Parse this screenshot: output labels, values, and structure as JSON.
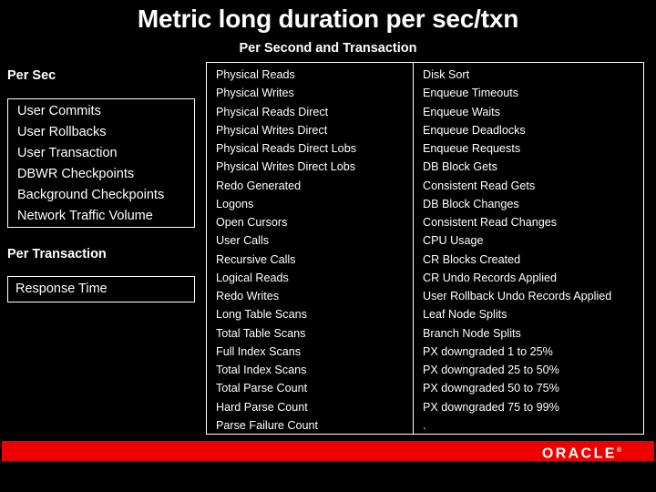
{
  "slide": {
    "title": "Metric long duration per sec/txn",
    "subtitle": "Per Second and Transaction",
    "background_color": "#000000",
    "text_color": "#ffffff",
    "accent_color": "#ee0000"
  },
  "left": {
    "per_sec_heading": "Per Sec",
    "per_sec_items": [
      "User Commits",
      "User Rollbacks",
      "User Transaction",
      "DBWR Checkpoints",
      "Background Checkpoints",
      "Network Traffic Volume"
    ],
    "per_transaction_heading": "Per Transaction",
    "per_transaction_items": [
      "Response Time"
    ]
  },
  "middle": {
    "items": [
      "Physical Reads",
      "Physical Writes",
      "Physical Reads Direct",
      "Physical Writes Direct",
      "Physical Reads Direct Lobs",
      "Physical Writes Direct Lobs",
      "Redo Generated",
      "Logons",
      "Open Cursors",
      "User Calls",
      "Recursive Calls",
      "Logical Reads",
      "Redo Writes",
      "Long Table Scans",
      "Total Table Scans",
      "Full Index Scans",
      "Total Index Scans",
      "Total Parse Count",
      "Hard Parse Count",
      "Parse Failure Count"
    ]
  },
  "right": {
    "items": [
      "Disk Sort",
      "Enqueue Timeouts",
      "Enqueue Waits",
      "Enqueue Deadlocks",
      "Enqueue Requests",
      "DB Block Gets",
      "Consistent Read Gets",
      "DB Block Changes",
      "Consistent Read Changes",
      "CPU Usage",
      "CR Blocks Created",
      "CR Undo Records Applied",
      "User Rollback Undo  Records Applied",
      "Leaf Node Splits",
      "Branch Node Splits",
      "PX downgraded 1 to 25%",
      "PX downgraded 25 to 50%",
      "PX downgraded 50 to 75%",
      "PX downgraded 75 to 99%",
      "."
    ]
  },
  "footer": {
    "brand": "ORACLE",
    "trademark": "®"
  }
}
